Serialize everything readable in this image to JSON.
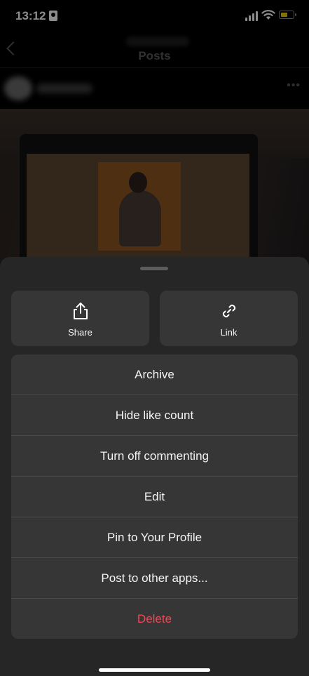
{
  "status_bar": {
    "time": "13:12",
    "battery_color": "#f5d000"
  },
  "nav": {
    "title": "Posts"
  },
  "post": {
    "more_label": "•••"
  },
  "sheet": {
    "actions": [
      {
        "label": "Share",
        "icon": "share-icon"
      },
      {
        "label": "Link",
        "icon": "link-icon"
      }
    ],
    "items": [
      {
        "label": "Archive"
      },
      {
        "label": "Hide like count"
      },
      {
        "label": "Turn off commenting"
      },
      {
        "label": "Edit"
      },
      {
        "label": "Pin to Your Profile"
      },
      {
        "label": "Post to other apps..."
      },
      {
        "label": "Delete",
        "style": "danger"
      }
    ]
  },
  "colors": {
    "danger": "#ed4956",
    "sheet_bg": "#262626",
    "button_bg": "#363636"
  }
}
